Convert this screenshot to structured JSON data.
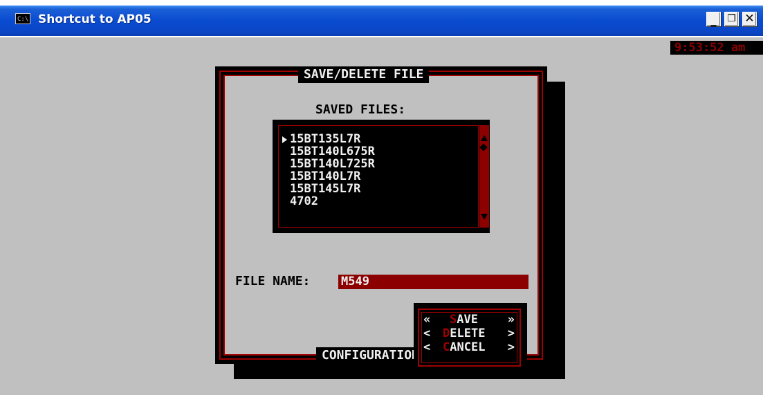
{
  "window": {
    "title": "Shortcut to AP05",
    "icon": "console-icon",
    "icon_text": "C:\\",
    "buttons": {
      "minimize": "_",
      "maximize": "❐",
      "close": "✕"
    }
  },
  "clock": "9:53:52 am",
  "dialog": {
    "title": "SAVE/DELETE FILE",
    "footer": "CONFIGURATION",
    "saved_files_label": "SAVED FILES:",
    "files": [
      "15BT135L7R",
      "15BT140L675R",
      "15BT140L725R",
      "15BT140L7R",
      "15BT145L7R",
      "4702"
    ],
    "selected_index": 0,
    "file_name_label": "FILE NAME:",
    "file_name_value": "M549",
    "actions": {
      "save": {
        "left": "«",
        "hot": "S",
        "rest": "AVE",
        "right": "»"
      },
      "delete": {
        "left": "<",
        "hot": "D",
        "rest": "ELETE",
        "right": ">"
      },
      "cancel": {
        "left": "<",
        "hot": "C",
        "rest": "ANCEL",
        "right": ">"
      }
    }
  },
  "colors": {
    "titlebar": "#0a4bd0",
    "console_bg": "#c0c0c0",
    "accent_red": "#a00000",
    "input_bg": "#8c0000",
    "panel_black": "#000000",
    "text_light": "#f0f0f0"
  }
}
